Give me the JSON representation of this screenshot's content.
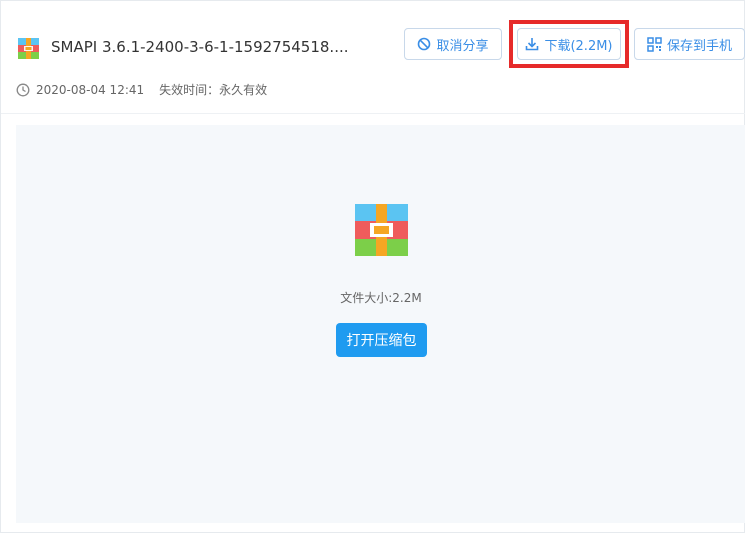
{
  "file": {
    "name": "SMAPI 3.6.1-2400-3-6-1-1592754518....",
    "date": "2020-08-04 12:41",
    "expire_label": "失效时间：永久有效"
  },
  "actions": {
    "cancel_share": "取消分享",
    "download": "下载(2.2M)",
    "save_to_phone": "保存到手机"
  },
  "preview": {
    "size_text": "文件大小:2.2M",
    "open_archive": "打开压缩包"
  },
  "colors": {
    "accent": "#1f9bf0",
    "highlight": "#e62a2a"
  }
}
